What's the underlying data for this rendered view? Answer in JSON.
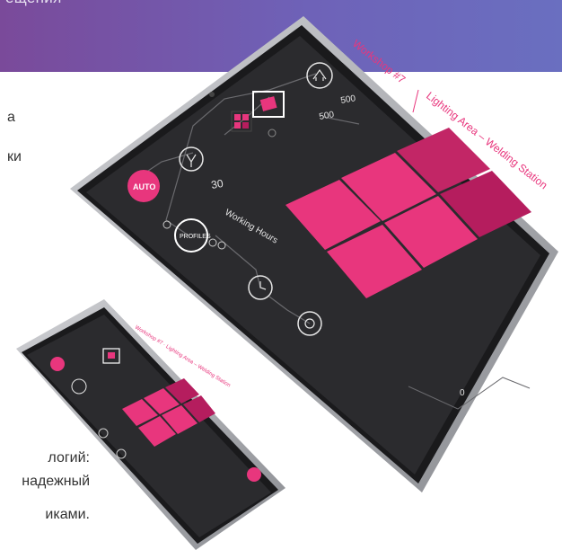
{
  "banner": {
    "text": "ещения"
  },
  "side": {
    "a": "а",
    "ki": "ки",
    "bottom1": "логий:",
    "bottom2": "надежный",
    "bottom3": "иками."
  },
  "tablet": {
    "title_workshop": "Workshop #7",
    "title_area": "Lighting Area – Welding Station",
    "auto_label": "AUTO",
    "profiles_label": "PROFILES",
    "working_hours": "Working Hours",
    "val_500a": "500",
    "val_500b": "500",
    "val_30": "30",
    "zero": "0",
    "tile_color": "#e8367d",
    "tile_color_dark": "#b51d5e",
    "screen_color": "#2b2b2e"
  },
  "phone": {
    "title": "Workshop #7 · Lighting Area – Welding Station"
  },
  "colors": {
    "accent": "#e8367d",
    "banner": "#6e62b8"
  }
}
